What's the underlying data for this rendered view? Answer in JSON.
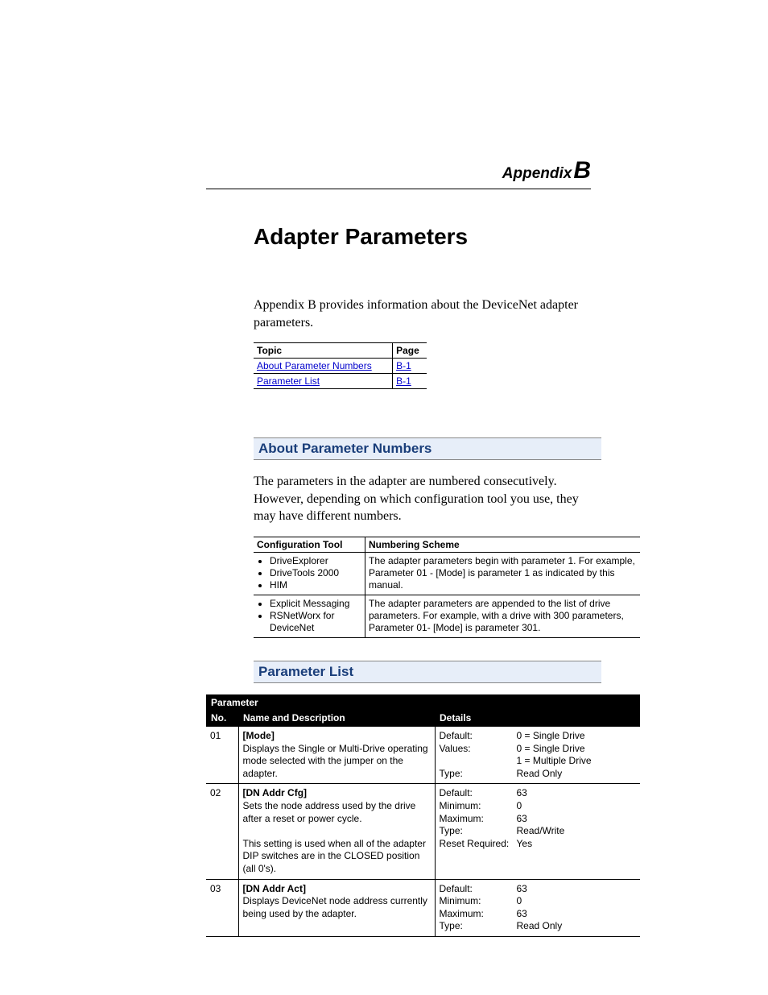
{
  "header": {
    "appendix_word": "Appendix",
    "appendix_letter": "B"
  },
  "title": "Adapter Parameters",
  "intro": "Appendix B provides information about the DeviceNet adapter parameters.",
  "topic_table": {
    "col_topic": "Topic",
    "col_page": "Page",
    "rows": [
      {
        "topic": "About Parameter Numbers",
        "page": "B-1"
      },
      {
        "topic": "Parameter List",
        "page": "B-1"
      }
    ]
  },
  "sections": {
    "about": {
      "heading": "About Parameter Numbers",
      "body": "The parameters in the adapter are numbered consecutively. However, depending on which configuration tool you use, they may have different numbers.",
      "table": {
        "col_tool": "Configuration Tool",
        "col_scheme": "Numbering Scheme",
        "rows": [
          {
            "tools": [
              "DriveExplorer",
              "DriveTools 2000",
              "HIM"
            ],
            "scheme": "The adapter parameters begin with parameter 1. For example, Parameter 01 - [Mode] is parameter 1 as indicated by this manual."
          },
          {
            "tools": [
              "Explicit Messaging",
              "RSNetWorx for DeviceNet"
            ],
            "scheme": "The adapter parameters are appended to the list of drive parameters. For example, with a drive with 300 parameters, Parameter 01- [Mode] is parameter 301."
          }
        ]
      }
    },
    "paramlist": {
      "heading": "Parameter List",
      "table": {
        "super_header": "Parameter",
        "col_no": "No.",
        "col_name": "Name and Description",
        "col_details": "Details",
        "rows": [
          {
            "no": "01",
            "name": "[Mode]",
            "desc": "Displays the Single or Multi-Drive operating mode selected with the jumper on the adapter.",
            "details": [
              [
                "Default:",
                "0 = Single Drive"
              ],
              [
                "Values:",
                "0 = Single Drive"
              ],
              [
                "",
                "1 = Multiple Drive"
              ],
              [
                "Type:",
                "Read Only"
              ]
            ]
          },
          {
            "no": "02",
            "name": "[DN Addr Cfg]",
            "desc": "Sets the node address used by the drive after a reset or power cycle.",
            "desc2": "This setting is used when all of the adapter DIP switches are in the CLOSED position (all 0's).",
            "details": [
              [
                "Default:",
                "63"
              ],
              [
                "Minimum:",
                "0"
              ],
              [
                "Maximum:",
                "63"
              ],
              [
                "Type:",
                "Read/Write"
              ],
              [
                "Reset Required:",
                "Yes"
              ]
            ]
          },
          {
            "no": "03",
            "name": "[DN Addr Act]",
            "desc": "Displays DeviceNet node address currently being used by the adapter.",
            "details": [
              [
                "Default:",
                "63"
              ],
              [
                "Minimum:",
                "0"
              ],
              [
                "Maximum:",
                "63"
              ],
              [
                "Type:",
                "Read Only"
              ]
            ]
          }
        ]
      }
    }
  }
}
